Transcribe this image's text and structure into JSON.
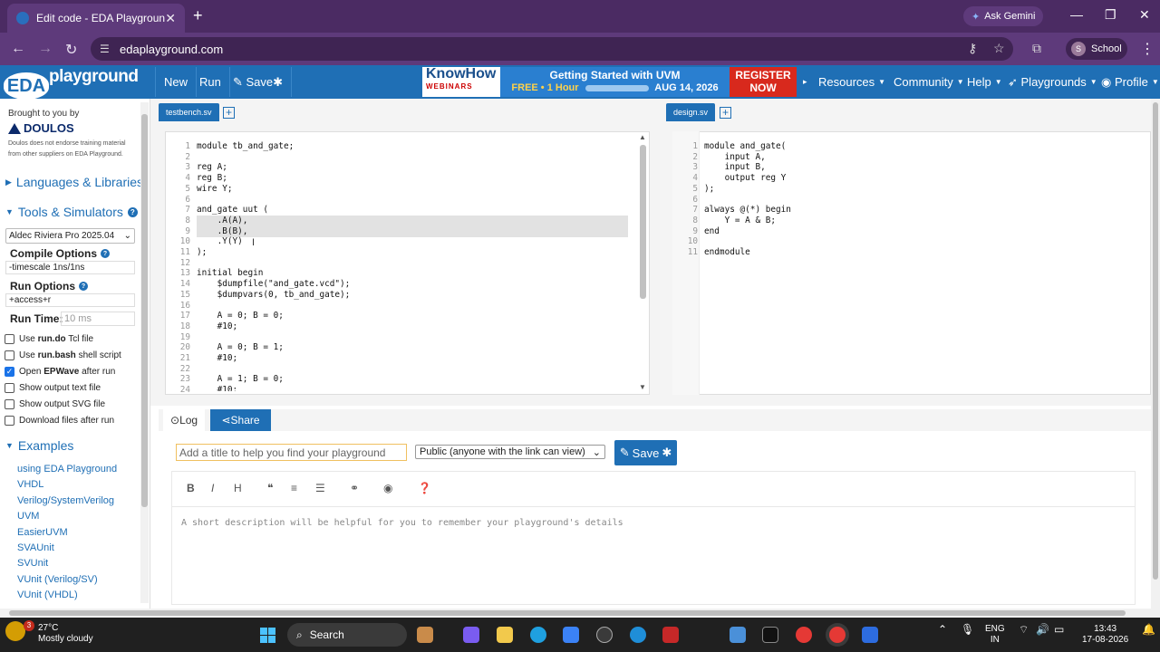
{
  "browser": {
    "tab_title": "Edit code - EDA Playground",
    "new_tab": "+",
    "ask_gemini": "Ask Gemini",
    "url": "edaplayground.com",
    "profile": "School",
    "profile_initial": "S"
  },
  "header": {
    "logo_eda": "EDA",
    "logo_playground": "playground",
    "new": "New",
    "run": "Run",
    "save": "Save",
    "banner": {
      "know": "KnowHow",
      "webinars": "WEBINARS",
      "title": "Getting Started with UVM",
      "free": "FREE • 1 Hour",
      "date": "AUG 14, 2026",
      "register": "REGISTER",
      "now": "NOW"
    },
    "resources": "Resources",
    "community": "Community",
    "help": "Help",
    "playgrounds": "Playgrounds",
    "profile": "Profile"
  },
  "sidebar": {
    "brought": "Brought to you by",
    "doulos": "DOULOS",
    "disclaimer": "Doulos does not endorse training material from other suppliers on EDA Playground.",
    "languages": "Languages & Libraries",
    "tools": "Tools & Simulators",
    "simulator": "Aldec Riviera Pro 2025.04",
    "compile_label": "Compile Options",
    "compile_value": "-timescale 1ns/1ns",
    "run_label": "Run Options",
    "run_value": "+access+r",
    "runtime_label": "Run Time:",
    "runtime_placeholder": "10 ms",
    "checks": [
      {
        "pre": "Use ",
        "bold": "run.do",
        "post": " Tcl file",
        "checked": false
      },
      {
        "pre": "Use ",
        "bold": "run.bash",
        "post": " shell script",
        "checked": false
      },
      {
        "pre": "Open ",
        "bold": "EPWave",
        "post": " after run",
        "checked": true
      },
      {
        "pre": "Show output text file",
        "bold": "",
        "post": "",
        "checked": false
      },
      {
        "pre": "Show output SVG file",
        "bold": "",
        "post": "",
        "checked": false
      },
      {
        "pre": "Download files after run",
        "bold": "",
        "post": "",
        "checked": false
      }
    ],
    "examples": "Examples",
    "example_links": [
      "using EDA Playground",
      "VHDL",
      "Verilog/SystemVerilog",
      "UVM",
      "EasierUVM",
      "SVAUnit",
      "SVUnit",
      "VUnit (Verilog/SV)",
      "VUnit (VHDL)"
    ]
  },
  "editors": {
    "left_tab": "testbench.sv",
    "right_tab": "design.sv",
    "left_lines": [
      {
        "n": "1",
        "t": "module tb_and_gate;"
      },
      {
        "n": "2",
        "t": ""
      },
      {
        "n": "3",
        "t": "reg A;"
      },
      {
        "n": "4",
        "t": "reg B;"
      },
      {
        "n": "5",
        "t": "wire Y;"
      },
      {
        "n": "6",
        "t": ""
      },
      {
        "n": "7",
        "t": "and_gate uut ("
      },
      {
        "n": "8",
        "t": "    .A(A),"
      },
      {
        "n": "9",
        "t": "    .B(B),"
      },
      {
        "n": "10",
        "t": "    .Y(Y)"
      },
      {
        "n": "11",
        "t": ");"
      },
      {
        "n": "12",
        "t": ""
      },
      {
        "n": "13",
        "t": "initial begin"
      },
      {
        "n": "14",
        "t": "    $dumpfile(\"and_gate.vcd\");"
      },
      {
        "n": "15",
        "t": "    $dumpvars(0, tb_and_gate);"
      },
      {
        "n": "16",
        "t": ""
      },
      {
        "n": "17",
        "t": "    A = 0; B = 0;"
      },
      {
        "n": "18",
        "t": "    #10;"
      },
      {
        "n": "19",
        "t": ""
      },
      {
        "n": "20",
        "t": "    A = 0; B = 1;"
      },
      {
        "n": "21",
        "t": "    #10;"
      },
      {
        "n": "22",
        "t": ""
      },
      {
        "n": "23",
        "t": "    A = 1; B = 0;"
      },
      {
        "n": "24",
        "t": "    #10;"
      }
    ],
    "right_lines": [
      {
        "n": "1",
        "t": "module and_gate("
      },
      {
        "n": "2",
        "t": "    input A,"
      },
      {
        "n": "3",
        "t": "    input B,"
      },
      {
        "n": "4",
        "t": "    output reg Y"
      },
      {
        "n": "5",
        "t": ");"
      },
      {
        "n": "6",
        "t": ""
      },
      {
        "n": "7",
        "t": "always @(*) begin"
      },
      {
        "n": "8",
        "t": "    Y = A & B;"
      },
      {
        "n": "9",
        "t": "end"
      },
      {
        "n": "10",
        "t": ""
      },
      {
        "n": "11",
        "t": "endmodule"
      }
    ]
  },
  "bottom": {
    "log_tab": "Log",
    "share_tab": "Share",
    "title_placeholder": "Add a title to help you find your playground",
    "visibility": "Public (anyone with the link can view)",
    "save": "Save",
    "md_placeholder": "A short description will be helpful for you to remember your playground's details"
  },
  "taskbar": {
    "temp": "27°C",
    "weather": "Mostly cloudy",
    "badge": "3",
    "search": "Search",
    "lang1": "ENG",
    "lang2": "IN",
    "time": "13:43",
    "date": "17-08-2026"
  }
}
